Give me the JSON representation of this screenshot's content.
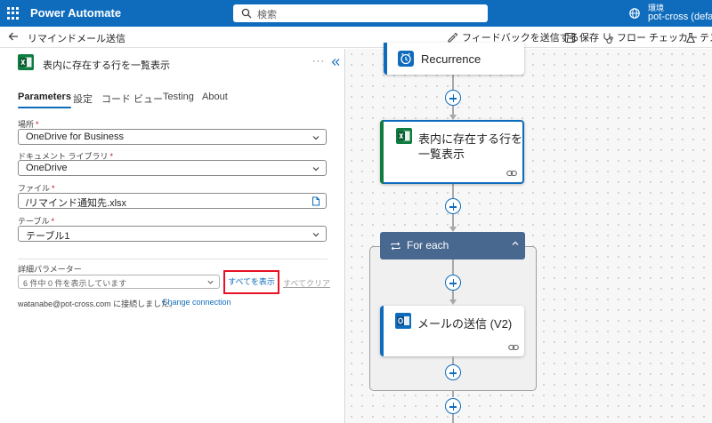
{
  "topbar": {
    "app_title": "Power Automate",
    "search_placeholder": "検索",
    "env_label": "環境",
    "env_name": "pot-cross (default)"
  },
  "cmdbar": {
    "flow_name": "リマインドメール送信",
    "feedback": "フィードバックを送信する",
    "save": "保存",
    "checker": "フロー チェッカー",
    "test": "テス"
  },
  "panel": {
    "title": "表内に存在する行を一覧表示",
    "more": "···",
    "tabs": [
      "Parameters",
      "設定",
      "コード ビュー",
      "Testing",
      "About"
    ],
    "fields": [
      {
        "label": "場所",
        "value": "OneDrive for Business"
      },
      {
        "label": "ドキュメント ライブラリ",
        "value": "OneDrive"
      },
      {
        "label": "ファイル",
        "value": "/リマインド通知先.xlsx"
      },
      {
        "label": "テーブル",
        "value": "テーブル1"
      }
    ],
    "required_mark": "*",
    "advanced_label": "詳細パラメーター",
    "advanced_value": "6 件中 0 件を表示しています",
    "show_all": "すべてを表示",
    "clear_all": "すべてクリア",
    "connection_text": "watanabe@pot-cross.com に接続しました。",
    "change_connection": "Change connection"
  },
  "canvas": {
    "recurrence": "Recurrence",
    "list_rows_line1": "表内に存在する行を",
    "list_rows_line2": "一覧表示",
    "for_each": "For each",
    "send_mail": "メールの送信 (V2)"
  },
  "colors": {
    "brand": "#0f6cbd",
    "excel": "#107c41",
    "foreach": "#49688f",
    "highlight": "#e81123"
  }
}
